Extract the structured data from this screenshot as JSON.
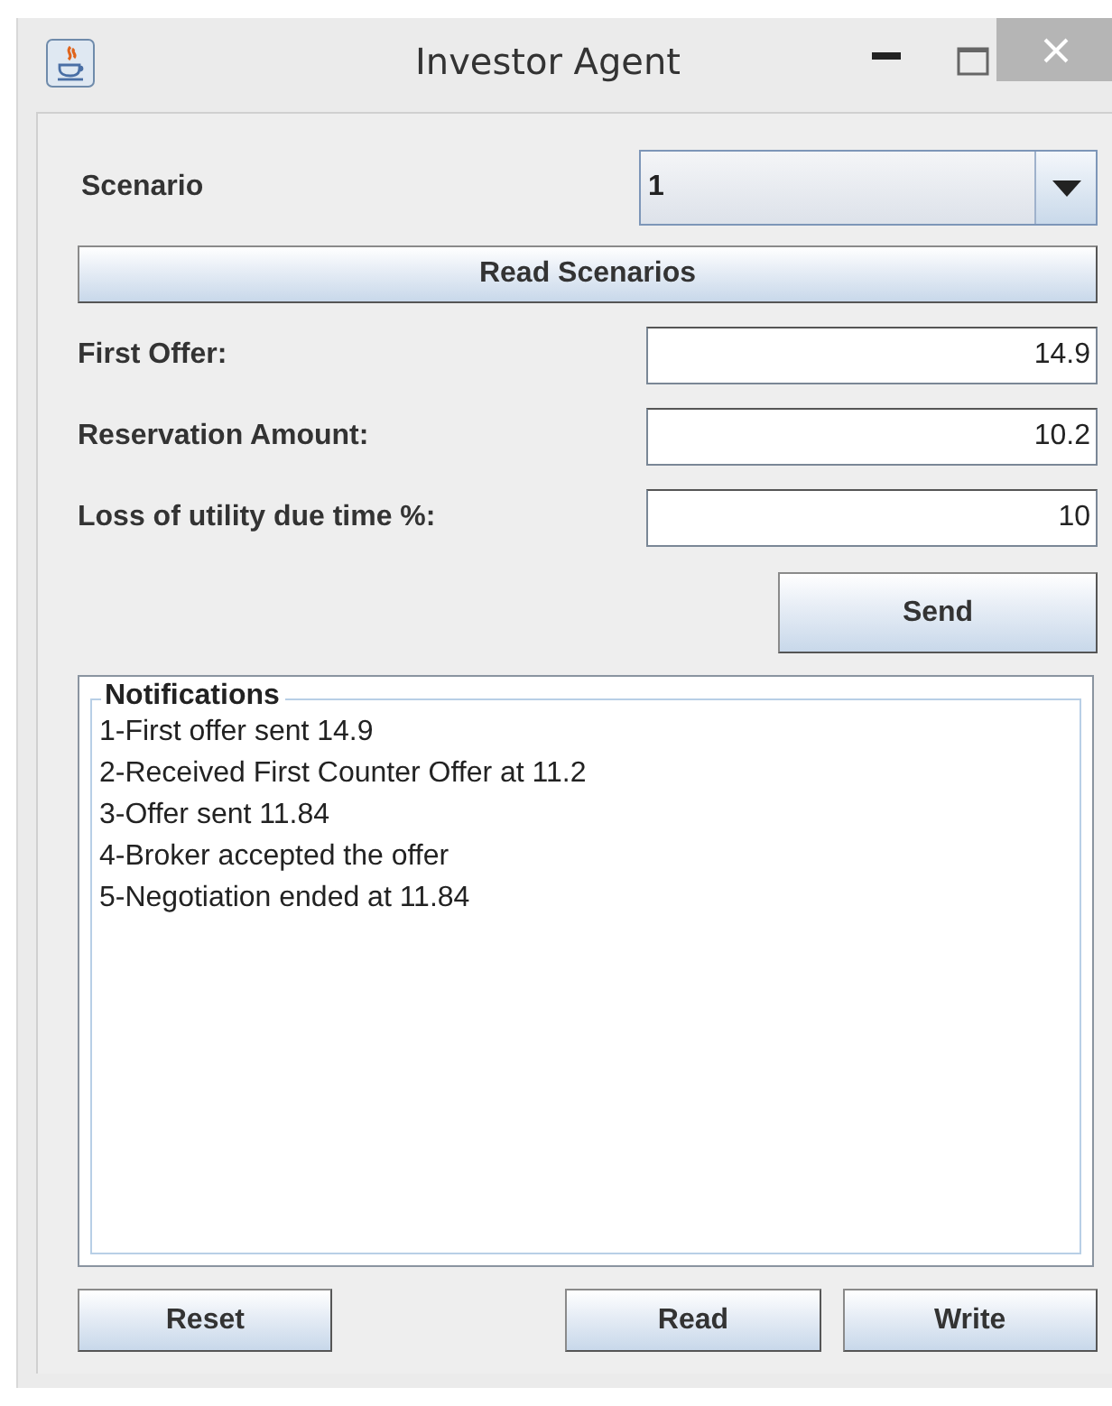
{
  "window": {
    "title": "Investor Agent"
  },
  "scenario": {
    "label": "Scenario",
    "value": "1"
  },
  "read_scenarios_button": "Read Scenarios",
  "fields": [
    {
      "label": "First Offer:",
      "value": "14.9"
    },
    {
      "label": "Reservation Amount:",
      "value": "10.2"
    },
    {
      "label": "Loss of utility due time %:",
      "value": "10"
    }
  ],
  "send_button": "Send",
  "notifications": {
    "title": "Notifications",
    "lines": [
      "1-First offer sent 14.9",
      "2-Received First Counter Offer at 11.2",
      "3-Offer sent 11.84",
      "4-Broker accepted the offer",
      "5-Negotiation ended at 11.84"
    ]
  },
  "bottom_buttons": [
    "Reset",
    "Read",
    "Write"
  ]
}
